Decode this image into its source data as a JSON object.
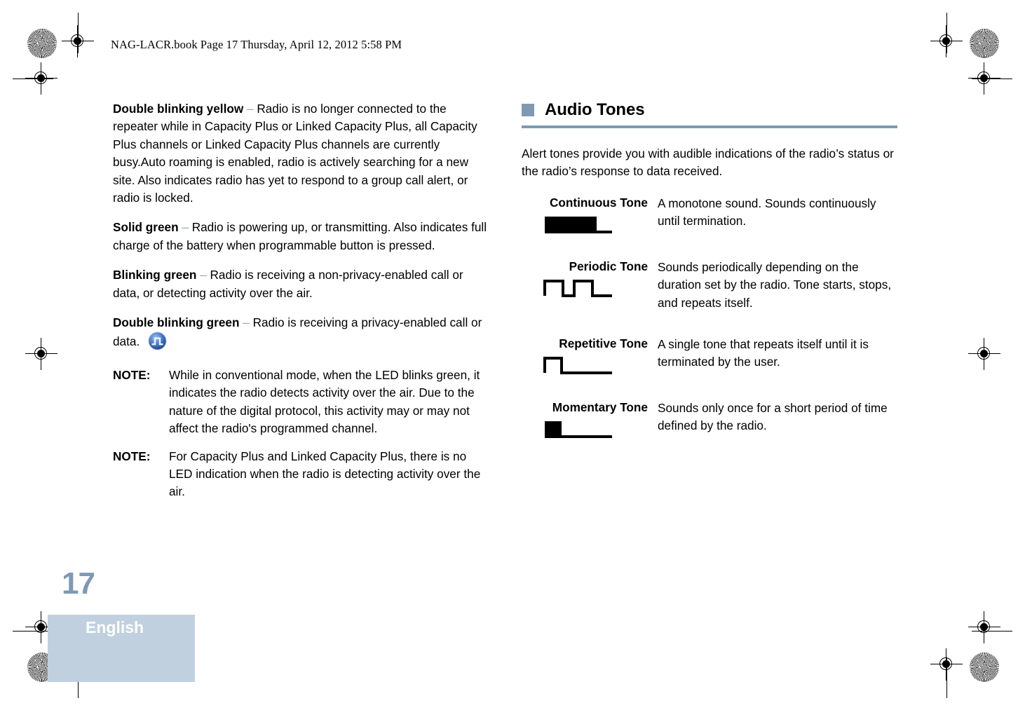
{
  "header": {
    "slug": "NAG-LACR.book  Page 17  Thursday, April 12, 2012  5:58 PM"
  },
  "colors": {
    "accent_slate": "#7f99b3",
    "band_light_blue": "#c0d0de",
    "dash_blue": "#8fa8c0",
    "icon_blue": "#2d5fb5",
    "text_black": "#000000"
  },
  "left_column": {
    "paragraphs": [
      {
        "term": "Double blinking yellow",
        "dash": " – ",
        "text": "Radio is no longer connected to the repeater while in Capacity Plus or Linked Capacity Plus, all Capacity Plus channels or Linked Capacity Plus channels are currently busy.Auto roaming is enabled, radio is actively searching for a new site. Also indicates radio has yet to respond to a group call alert, or radio is locked."
      },
      {
        "term": "Solid green",
        "dash": " – ",
        "text": "Radio is powering up, or transmitting. Also indicates full charge of the battery when programmable button is pressed."
      },
      {
        "term": "Blinking green",
        "dash": " – ",
        "text": "Radio is receiving a non-privacy-enabled call or data, or detecting activity over the air."
      },
      {
        "term": "Double blinking green",
        "dash": " – ",
        "text": "Radio is receiving a privacy-enabled call or data. ",
        "trailing_icon": "privacy-pulse-icon"
      }
    ],
    "notes": [
      {
        "label": "NOTE:",
        "text": "While in conventional mode, when the LED blinks green, it indicates the radio detects activity over the air. Due to the nature of the digital protocol, this activity may or may not affect the radio's programmed channel."
      },
      {
        "label": "NOTE:",
        "text": "For Capacity Plus and Linked Capacity Plus, there is no LED indication when the radio is detecting activity over the air."
      }
    ]
  },
  "right_column": {
    "heading": "Audio Tones",
    "intro": "Alert tones provide you with audible indications of the radio’s status or the radio’s response to data received.",
    "tones": [
      {
        "name": "Continuous Tone",
        "waveform": "continuous-waveform",
        "description": "A monotone sound. Sounds continuously until termination."
      },
      {
        "name": "Periodic Tone",
        "waveform": "periodic-waveform",
        "description": "Sounds periodically depending on the duration set by the radio. Tone starts, stops, and repeats itself."
      },
      {
        "name": "Repetitive Tone",
        "waveform": "repetitive-waveform",
        "description": "A single tone that repeats itself until it is terminated by the user."
      },
      {
        "name": "Momentary Tone",
        "waveform": "momentary-waveform",
        "description": "Sounds only once for a short period of time defined by the radio."
      }
    ]
  },
  "footer": {
    "page_number": "17",
    "language": "English"
  }
}
